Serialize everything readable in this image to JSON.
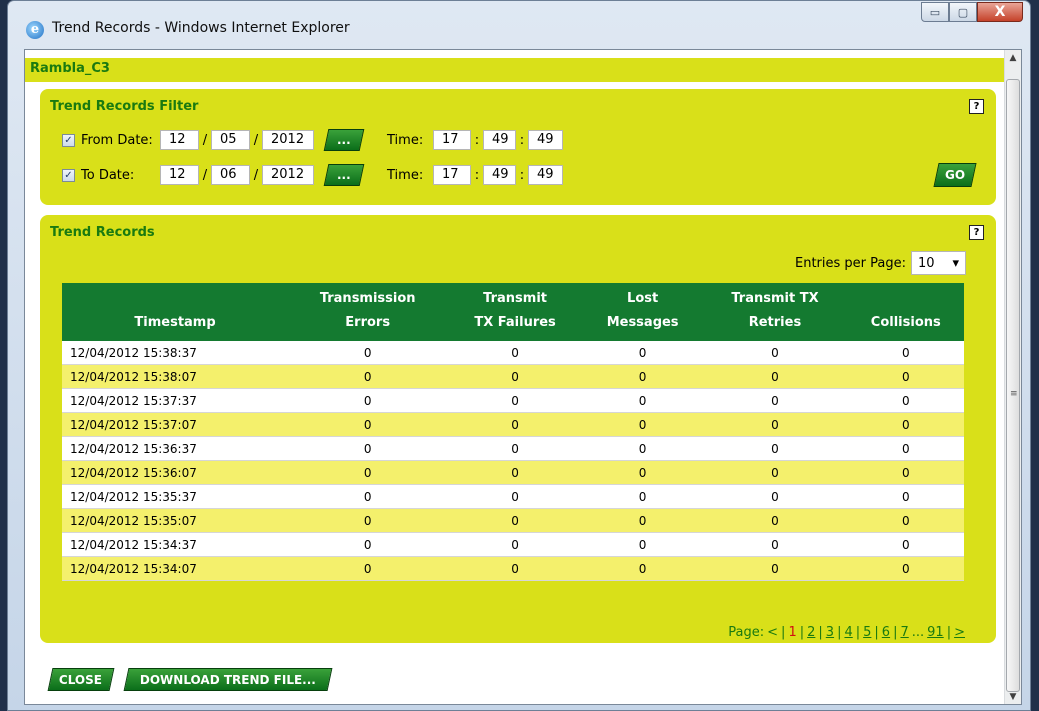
{
  "window": {
    "title": "Trend Records - Windows Internet Explorer",
    "controls": {
      "minimize": "▭",
      "maximize": "▢",
      "close": "X"
    }
  },
  "device_name": "Rambla_C3",
  "filter": {
    "title": "Trend Records Filter",
    "help": "?",
    "from": {
      "checked": true,
      "label": "From Date:",
      "month": "12",
      "day": "05",
      "year": "2012",
      "cal_button": "...",
      "time_label": "Time:",
      "hh": "17",
      "mm": "49",
      "ss": "49"
    },
    "to": {
      "checked": true,
      "label": "To Date:",
      "month": "12",
      "day": "06",
      "year": "2012",
      "cal_button": "...",
      "time_label": "Time:",
      "hh": "17",
      "mm": "49",
      "ss": "49"
    },
    "date_sep": "/",
    "time_sep": ":",
    "go_button": "GO"
  },
  "records": {
    "title": "Trend Records",
    "help": "?",
    "entries_label": "Entries per Page:",
    "entries_value": "10",
    "columns": [
      {
        "line1": "",
        "line2": "Timestamp"
      },
      {
        "line1": "Transmission",
        "line2": "Errors"
      },
      {
        "line1": "Transmit",
        "line2": "TX Failures"
      },
      {
        "line1": "Lost",
        "line2": "Messages"
      },
      {
        "line1": "Transmit TX",
        "line2": "Retries"
      },
      {
        "line1": "Collisions",
        "line2": ""
      }
    ],
    "rows": [
      [
        "12/04/2012 15:38:37",
        "0",
        "0",
        "0",
        "0",
        "0"
      ],
      [
        "12/04/2012 15:38:07",
        "0",
        "0",
        "0",
        "0",
        "0"
      ],
      [
        "12/04/2012 15:37:37",
        "0",
        "0",
        "0",
        "0",
        "0"
      ],
      [
        "12/04/2012 15:37:07",
        "0",
        "0",
        "0",
        "0",
        "0"
      ],
      [
        "12/04/2012 15:36:37",
        "0",
        "0",
        "0",
        "0",
        "0"
      ],
      [
        "12/04/2012 15:36:07",
        "0",
        "0",
        "0",
        "0",
        "0"
      ],
      [
        "12/04/2012 15:35:37",
        "0",
        "0",
        "0",
        "0",
        "0"
      ],
      [
        "12/04/2012 15:35:07",
        "0",
        "0",
        "0",
        "0",
        "0"
      ],
      [
        "12/04/2012 15:34:37",
        "0",
        "0",
        "0",
        "0",
        "0"
      ],
      [
        "12/04/2012 15:34:07",
        "0",
        "0",
        "0",
        "0",
        "0"
      ]
    ],
    "pager": {
      "label": "Page:",
      "prev": "<",
      "current": "1",
      "pages": [
        "2",
        "3",
        "4",
        "5",
        "6",
        "7"
      ],
      "ellipsis": "...",
      "last": "91",
      "next": ">"
    }
  },
  "buttons": {
    "close": "CLOSE",
    "download": "DOWNLOAD TREND FILE..."
  },
  "colors": {
    "panel": "#d9e019",
    "header": "#147a30",
    "accent_text": "#1a7a10",
    "alt_row": "#f4f06c"
  }
}
